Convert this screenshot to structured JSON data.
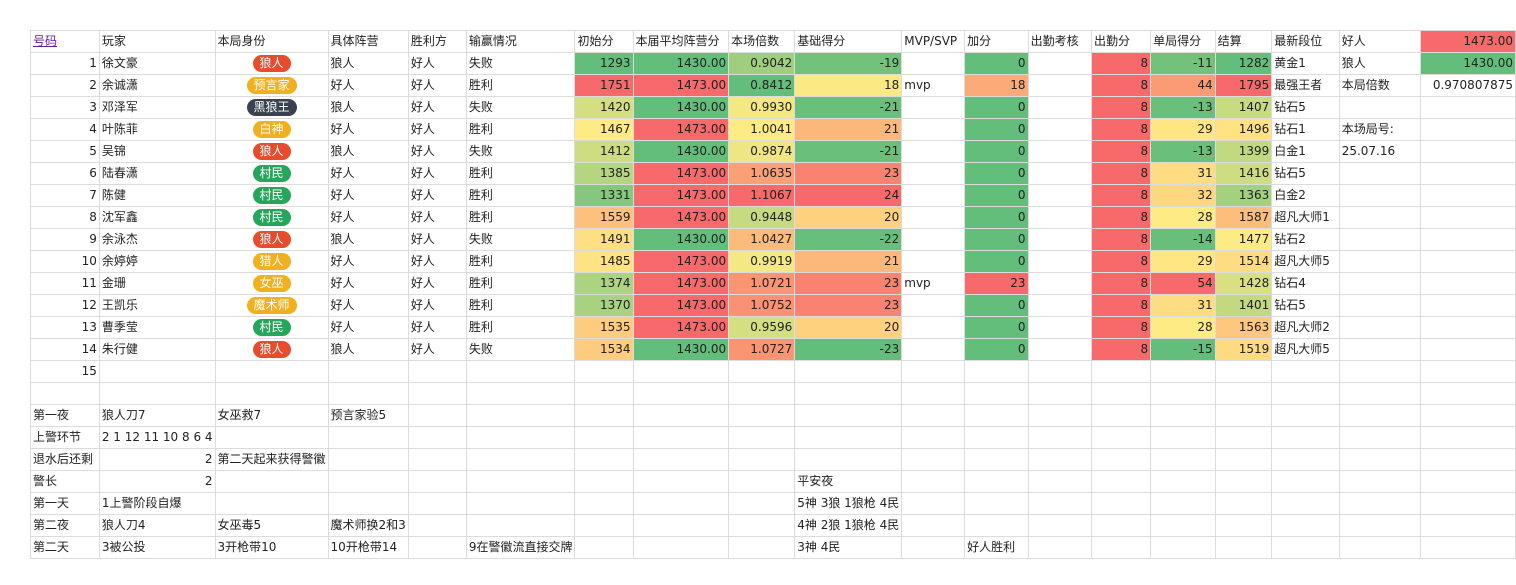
{
  "headers": [
    "号码",
    "玩家",
    "本局身份",
    "具体阵营",
    "胜利方",
    "输赢情况",
    "初始分",
    "本届平均阵营分",
    "本场倍数",
    "基础得分",
    "MVP/SVP",
    "加分",
    "出勤考核",
    "出勤分",
    "单局得分",
    "结算",
    "最新段位",
    "好人",
    "1473.00"
  ],
  "side": [
    [
      "狼人",
      "1430.00"
    ],
    [
      "本局倍数",
      "0.970807875"
    ],
    [
      "",
      ""
    ],
    [
      "本场局号:",
      ""
    ],
    [
      "25.07.16",
      ""
    ]
  ],
  "rows": [
    {
      "num": "1",
      "name": "徐文豪",
      "role": "狼人",
      "role_type": "wolf",
      "camp": "狼人",
      "winner": "好人",
      "result": "失败",
      "init": "1293",
      "avg": "1430.00",
      "mult": "0.9042",
      "base": "-19",
      "mvp": "",
      "bonus": "0",
      "att": "",
      "att_score": "8",
      "single": "-11",
      "total": "1282",
      "rank": "黄金1"
    },
    {
      "num": "2",
      "name": "余诚潇",
      "role": "预言家",
      "role_type": "god",
      "camp": "好人",
      "winner": "好人",
      "result": "胜利",
      "init": "1751",
      "avg": "1473.00",
      "mult": "0.8412",
      "base": "18",
      "mvp": "mvp",
      "bonus": "18",
      "att": "",
      "att_score": "8",
      "single": "44",
      "total": "1795",
      "rank": "最强王者"
    },
    {
      "num": "3",
      "name": "邓泽军",
      "role": "黑狼王",
      "role_type": "black",
      "camp": "狼人",
      "winner": "好人",
      "result": "失败",
      "init": "1420",
      "avg": "1430.00",
      "mult": "0.9930",
      "base": "-21",
      "mvp": "",
      "bonus": "0",
      "att": "",
      "att_score": "8",
      "single": "-13",
      "total": "1407",
      "rank": "钻石5"
    },
    {
      "num": "4",
      "name": "叶陈菲",
      "role": "白神",
      "role_type": "god",
      "camp": "好人",
      "winner": "好人",
      "result": "胜利",
      "init": "1467",
      "avg": "1473.00",
      "mult": "1.0041",
      "base": "21",
      "mvp": "",
      "bonus": "0",
      "att": "",
      "att_score": "8",
      "single": "29",
      "total": "1496",
      "rank": "钻石1"
    },
    {
      "num": "5",
      "name": "吴锦",
      "role": "狼人",
      "role_type": "wolf",
      "camp": "狼人",
      "winner": "好人",
      "result": "失败",
      "init": "1412",
      "avg": "1430.00",
      "mult": "0.9874",
      "base": "-21",
      "mvp": "",
      "bonus": "0",
      "att": "",
      "att_score": "8",
      "single": "-13",
      "total": "1399",
      "rank": "白金1"
    },
    {
      "num": "6",
      "name": "陆春潇",
      "role": "村民",
      "role_type": "village",
      "camp": "好人",
      "winner": "好人",
      "result": "胜利",
      "init": "1385",
      "avg": "1473.00",
      "mult": "1.0635",
      "base": "23",
      "mvp": "",
      "bonus": "0",
      "att": "",
      "att_score": "8",
      "single": "31",
      "total": "1416",
      "rank": "钻石5"
    },
    {
      "num": "7",
      "name": "陈健",
      "role": "村民",
      "role_type": "village",
      "camp": "好人",
      "winner": "好人",
      "result": "胜利",
      "init": "1331",
      "avg": "1473.00",
      "mult": "1.1067",
      "base": "24",
      "mvp": "",
      "bonus": "0",
      "att": "",
      "att_score": "8",
      "single": "32",
      "total": "1363",
      "rank": "白金2"
    },
    {
      "num": "8",
      "name": "沈军鑫",
      "role": "村民",
      "role_type": "village",
      "camp": "好人",
      "winner": "好人",
      "result": "胜利",
      "init": "1559",
      "avg": "1473.00",
      "mult": "0.9448",
      "base": "20",
      "mvp": "",
      "bonus": "0",
      "att": "",
      "att_score": "8",
      "single": "28",
      "total": "1587",
      "rank": "超凡大师1"
    },
    {
      "num": "9",
      "name": "余泳杰",
      "role": "狼人",
      "role_type": "wolf",
      "camp": "狼人",
      "winner": "好人",
      "result": "失败",
      "init": "1491",
      "avg": "1430.00",
      "mult": "1.0427",
      "base": "-22",
      "mvp": "",
      "bonus": "0",
      "att": "",
      "att_score": "8",
      "single": "-14",
      "total": "1477",
      "rank": "钻石2"
    },
    {
      "num": "10",
      "name": "余婷婷",
      "role": "猎人",
      "role_type": "god",
      "camp": "好人",
      "winner": "好人",
      "result": "胜利",
      "init": "1485",
      "avg": "1473.00",
      "mult": "0.9919",
      "base": "21",
      "mvp": "",
      "bonus": "0",
      "att": "",
      "att_score": "8",
      "single": "29",
      "total": "1514",
      "rank": "超凡大师5"
    },
    {
      "num": "11",
      "name": "金珊",
      "role": "女巫",
      "role_type": "god",
      "camp": "好人",
      "winner": "好人",
      "result": "胜利",
      "init": "1374",
      "avg": "1473.00",
      "mult": "1.0721",
      "base": "23",
      "mvp": "mvp",
      "bonus": "23",
      "att": "",
      "att_score": "8",
      "single": "54",
      "total": "1428",
      "rank": "钻石4"
    },
    {
      "num": "12",
      "name": "王凯乐",
      "role": "魔术师",
      "role_type": "god",
      "camp": "好人",
      "winner": "好人",
      "result": "胜利",
      "init": "1370",
      "avg": "1473.00",
      "mult": "1.0752",
      "base": "23",
      "mvp": "",
      "bonus": "0",
      "att": "",
      "att_score": "8",
      "single": "31",
      "total": "1401",
      "rank": "钻石5"
    },
    {
      "num": "13",
      "name": "曹季莹",
      "role": "村民",
      "role_type": "village",
      "camp": "好人",
      "winner": "好人",
      "result": "胜利",
      "init": "1535",
      "avg": "1473.00",
      "mult": "0.9596",
      "base": "20",
      "mvp": "",
      "bonus": "0",
      "att": "",
      "att_score": "8",
      "single": "28",
      "total": "1563",
      "rank": "超凡大师2"
    },
    {
      "num": "14",
      "name": "朱行健",
      "role": "狼人",
      "role_type": "wolf",
      "camp": "狼人",
      "winner": "好人",
      "result": "失败",
      "init": "1534",
      "avg": "1430.00",
      "mult": "1.0727",
      "base": "-23",
      "mvp": "",
      "bonus": "0",
      "att": "",
      "att_score": "8",
      "single": "-15",
      "total": "1519",
      "rank": "超凡大师5"
    }
  ],
  "row15_num": "15",
  "notes": [
    {
      "a": "第一夜",
      "b": "狼人刀7",
      "c": "女巫救7",
      "d": "预言家验5",
      "j": "",
      "l": ""
    },
    {
      "a": "上警环节",
      "b": "2 1 12 11 10 8 6 4",
      "c": "",
      "d": "",
      "j": "",
      "l": ""
    },
    {
      "a": "退水后还剩",
      "b": "2",
      "c": "第二天起来获得警徽",
      "d": "",
      "j": "",
      "l": ""
    },
    {
      "a": "警长",
      "b": "2",
      "c": "",
      "d": "",
      "j": "平安夜",
      "l": ""
    },
    {
      "a": "第一天",
      "b": "1上警阶段自爆",
      "c": "",
      "d": "",
      "j": "5神 3狼 1狼枪 4民",
      "l": ""
    },
    {
      "a": "第二夜",
      "b": "狼人刀4",
      "c": "女巫毒5",
      "d": "魔术师换2和3",
      "j": "4神 2狼 1狼枪 4民",
      "l": ""
    },
    {
      "a": "第二天",
      "b": "3被公投",
      "c": "3开枪带10",
      "d": "10开枪带14",
      "f": "9在警徽流直接交牌",
      "j": "3神 4民",
      "l": "好人胜利"
    }
  ],
  "colors": {
    "red": "#f8696b",
    "green": "#63be7b",
    "wolf": "#e74c2c",
    "god": "#f0b020",
    "black": "#3a4250",
    "village": "#26a65b"
  }
}
